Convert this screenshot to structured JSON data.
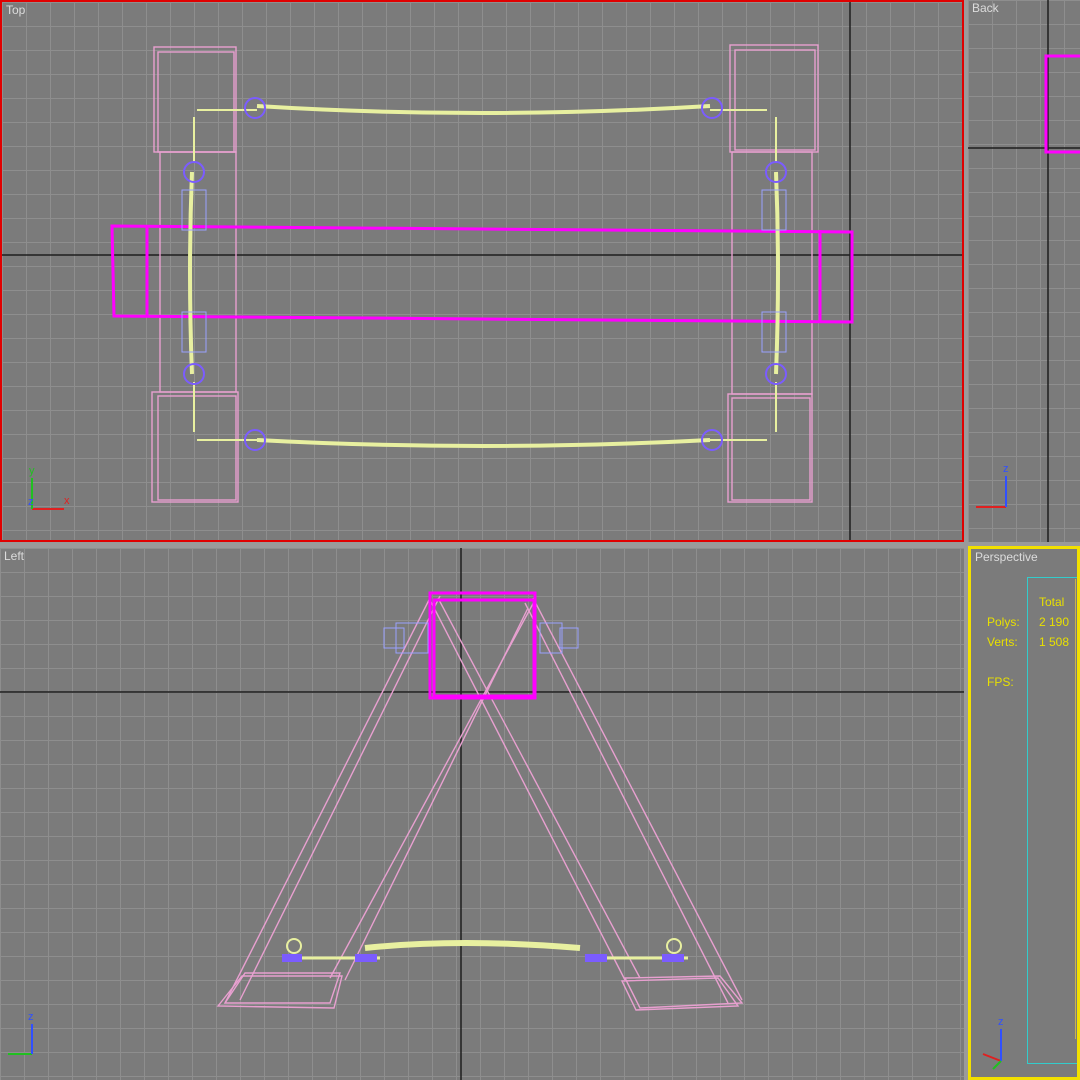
{
  "viewports": {
    "top": {
      "label": "Top"
    },
    "back": {
      "label": "Back"
    },
    "left": {
      "label": "Left"
    },
    "perspective": {
      "label": "Perspective"
    }
  },
  "stats": {
    "column_header": "Total",
    "polys_label": "Polys:",
    "polys_value": "2 190",
    "verts_label": "Verts:",
    "verts_value": "1 508",
    "fps_label": "FPS:"
  },
  "axis_labels": {
    "x": "x",
    "y": "y",
    "z": "z"
  },
  "colors": {
    "active_viewport_border": "#f2e000",
    "selected_viewport_border": "#e00000",
    "object_pink": "#e8a0d0",
    "object_magenta": "#ff00ff",
    "object_yellow": "#e8f0a0",
    "object_purple": "#7b5cff",
    "grid_major": "#1e1e1e"
  },
  "icons": [
    "axis-tripod-icon"
  ]
}
